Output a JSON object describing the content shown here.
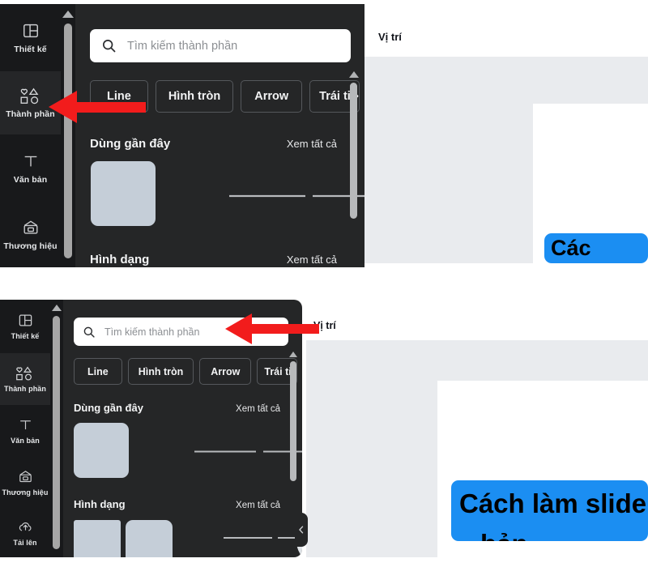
{
  "app": {
    "name": "Canva Editor",
    "accent_blue": "#1b8ef2",
    "annotation_red": "#f21c1c",
    "panel_bg": "#252627",
    "rail_bg": "#18191b",
    "canvas_bg": "#e9ebee"
  },
  "sidebar": {
    "items": [
      {
        "label": "Thiết kế",
        "icon": "layout-icon",
        "active": false
      },
      {
        "label": "Thành phần",
        "icon": "shapes-icon",
        "active": true
      },
      {
        "label": "Văn bản",
        "icon": "text-t-icon",
        "active": false
      },
      {
        "label": "Thương hiệu",
        "icon": "brand-kit-icon",
        "active": false
      },
      {
        "label": "Tải lên",
        "icon": "upload-cloud-icon",
        "active": false
      }
    ]
  },
  "search": {
    "placeholder": "Tìm kiếm thành phần",
    "value": "",
    "icon": "search-icon"
  },
  "chips": [
    {
      "label": "Line"
    },
    {
      "label": "Hình tròn"
    },
    {
      "label": "Arrow"
    },
    {
      "label": "Trái tim",
      "truncated_label": "Trái ti",
      "chevron": "›"
    }
  ],
  "sections": [
    {
      "title": "Dùng gần đây",
      "link": "Xem tất cả"
    },
    {
      "title": "Hình dạng",
      "link": "Xem tất cả"
    }
  ],
  "canvas": {
    "toolbar_label": "Vị trí",
    "slide_title_line1": "Cách làm slide",
    "slide_title_line2": "bản",
    "slide_title_visible_top": "Các",
    "collapse_icon": "chevron-left-icon",
    "next_icon": "chevron-right-icon"
  },
  "annotations": [
    {
      "name": "arrow-to-sidebar-elements",
      "direction": "left",
      "target": "Thành phần"
    },
    {
      "name": "arrow-to-search-box",
      "direction": "left",
      "target": "Tìm kiếm thành phần"
    }
  ],
  "scrollbars": {
    "rail_caret": "▲",
    "panel_caret": "▲"
  }
}
